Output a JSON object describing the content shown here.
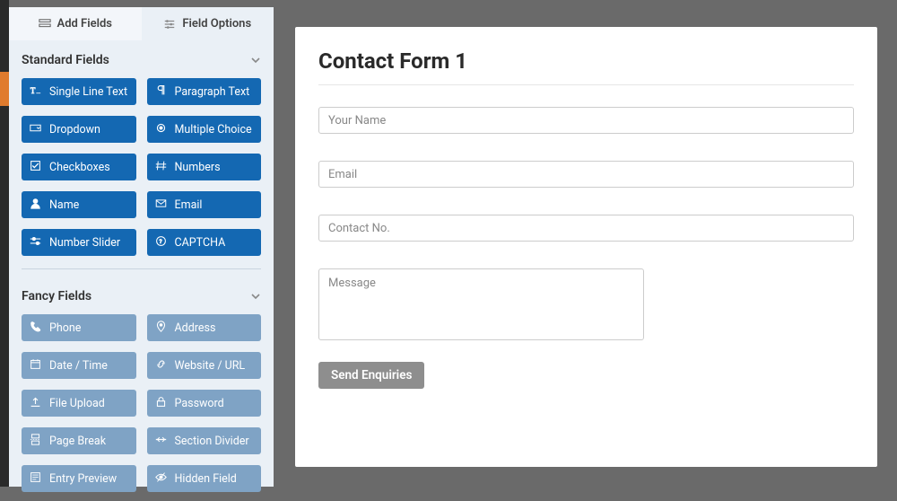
{
  "tabs": {
    "add_fields": "Add Fields",
    "field_options": "Field Options"
  },
  "sections": {
    "standard": {
      "title": "Standard Fields",
      "fields": [
        {
          "label": "Single Line Text",
          "icon": "text-icon"
        },
        {
          "label": "Paragraph Text",
          "icon": "paragraph-icon"
        },
        {
          "label": "Dropdown",
          "icon": "dropdown-icon"
        },
        {
          "label": "Multiple Choice",
          "icon": "radio-icon"
        },
        {
          "label": "Checkboxes",
          "icon": "check-icon"
        },
        {
          "label": "Numbers",
          "icon": "hash-icon"
        },
        {
          "label": "Name",
          "icon": "user-icon"
        },
        {
          "label": "Email",
          "icon": "envelope-icon"
        },
        {
          "label": "Number Slider",
          "icon": "slider-icon"
        },
        {
          "label": "CAPTCHA",
          "icon": "captcha-icon"
        }
      ]
    },
    "fancy": {
      "title": "Fancy Fields",
      "fields": [
        {
          "label": "Phone",
          "icon": "phone-icon"
        },
        {
          "label": "Address",
          "icon": "pin-icon"
        },
        {
          "label": "Date / Time",
          "icon": "calendar-icon"
        },
        {
          "label": "Website / URL",
          "icon": "link-icon"
        },
        {
          "label": "File Upload",
          "icon": "upload-icon"
        },
        {
          "label": "Password",
          "icon": "lock-icon"
        },
        {
          "label": "Page Break",
          "icon": "pagebreak-icon"
        },
        {
          "label": "Section Divider",
          "icon": "divider-icon"
        },
        {
          "label": "Entry Preview",
          "icon": "preview-icon"
        },
        {
          "label": "Hidden Field",
          "icon": "hidden-icon"
        }
      ]
    }
  },
  "form": {
    "title": "Contact Form 1",
    "fields": {
      "name_placeholder": "Your Name",
      "email_placeholder": "Email",
      "contact_placeholder": "Contact No.",
      "message_placeholder": "Message"
    },
    "submit_label": "Send Enquiries"
  }
}
